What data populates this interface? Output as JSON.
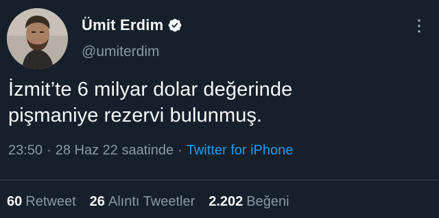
{
  "user": {
    "display_name": "Ümit Erdim",
    "handle": "@umiterdim",
    "verified": true
  },
  "tweet": {
    "text_lines": [
      "İzmit’te 6 milyar dolar değerinde",
      "pişmaniye rezervi bulunmuş."
    ]
  },
  "meta": {
    "time": "23:50",
    "separator": "·",
    "date": "28 Haz 22 saatinde",
    "source": "Twitter for iPhone"
  },
  "stats": [
    {
      "count": "60",
      "label": "Retweet"
    },
    {
      "count": "26",
      "label": "Alıntı Tweetler"
    },
    {
      "count": "2.202",
      "label": "Beğeni"
    }
  ],
  "colors": {
    "background": "#15202b",
    "text": "#f7f9f9",
    "secondary": "#8b98a5",
    "accent": "#1d9bf0",
    "divider": "#38444d"
  },
  "icons": {
    "verified": "verified-badge-icon",
    "more": "more-options-icon"
  }
}
